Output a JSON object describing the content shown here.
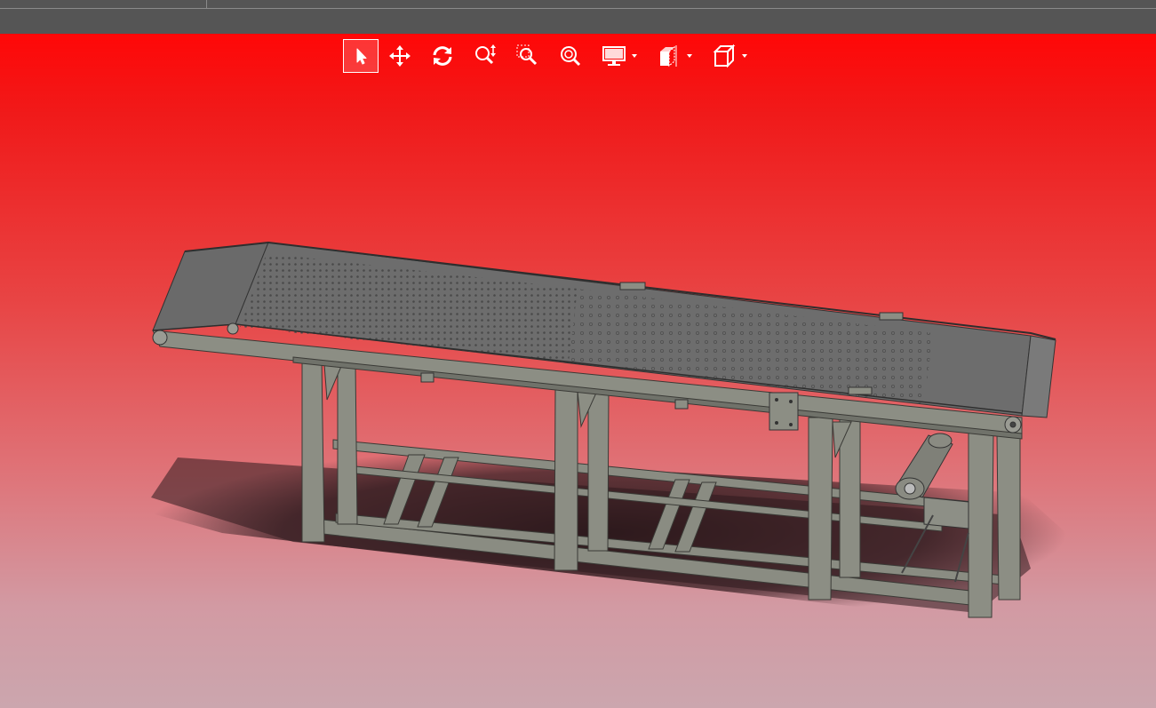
{
  "window": {
    "tab_label": ""
  },
  "toolbar": {
    "tools": [
      {
        "name": "select-tool",
        "icon": "cursor-arrow-icon",
        "selected": true,
        "has_dropdown": false
      },
      {
        "name": "pan-tool",
        "icon": "move-arrows-icon",
        "selected": false,
        "has_dropdown": false
      },
      {
        "name": "rotate-tool",
        "icon": "rotate-icon",
        "selected": false,
        "has_dropdown": false
      },
      {
        "name": "zoom-tool",
        "icon": "zoom-updown-icon",
        "selected": false,
        "has_dropdown": false
      },
      {
        "name": "zoom-area-tool",
        "icon": "zoom-area-icon",
        "selected": false,
        "has_dropdown": false
      },
      {
        "name": "zoom-fit-tool",
        "icon": "zoom-fit-icon",
        "selected": false,
        "has_dropdown": false
      },
      {
        "name": "display-mode-tool",
        "icon": "monitor-icon",
        "selected": false,
        "has_dropdown": true
      },
      {
        "name": "section-view-tool",
        "icon": "section-view-icon",
        "selected": false,
        "has_dropdown": true
      },
      {
        "name": "view-orientation-tool",
        "icon": "cube-icon",
        "selected": false,
        "has_dropdown": true
      }
    ]
  },
  "viewport": {
    "background_top": "#ff0707",
    "background_bottom": "#cba6ae",
    "model": "belt-conveyor-assembly",
    "model_color": "#8a8c82",
    "belt_color": "#6c6c6c",
    "shadow_color": "#2a1a1c"
  }
}
